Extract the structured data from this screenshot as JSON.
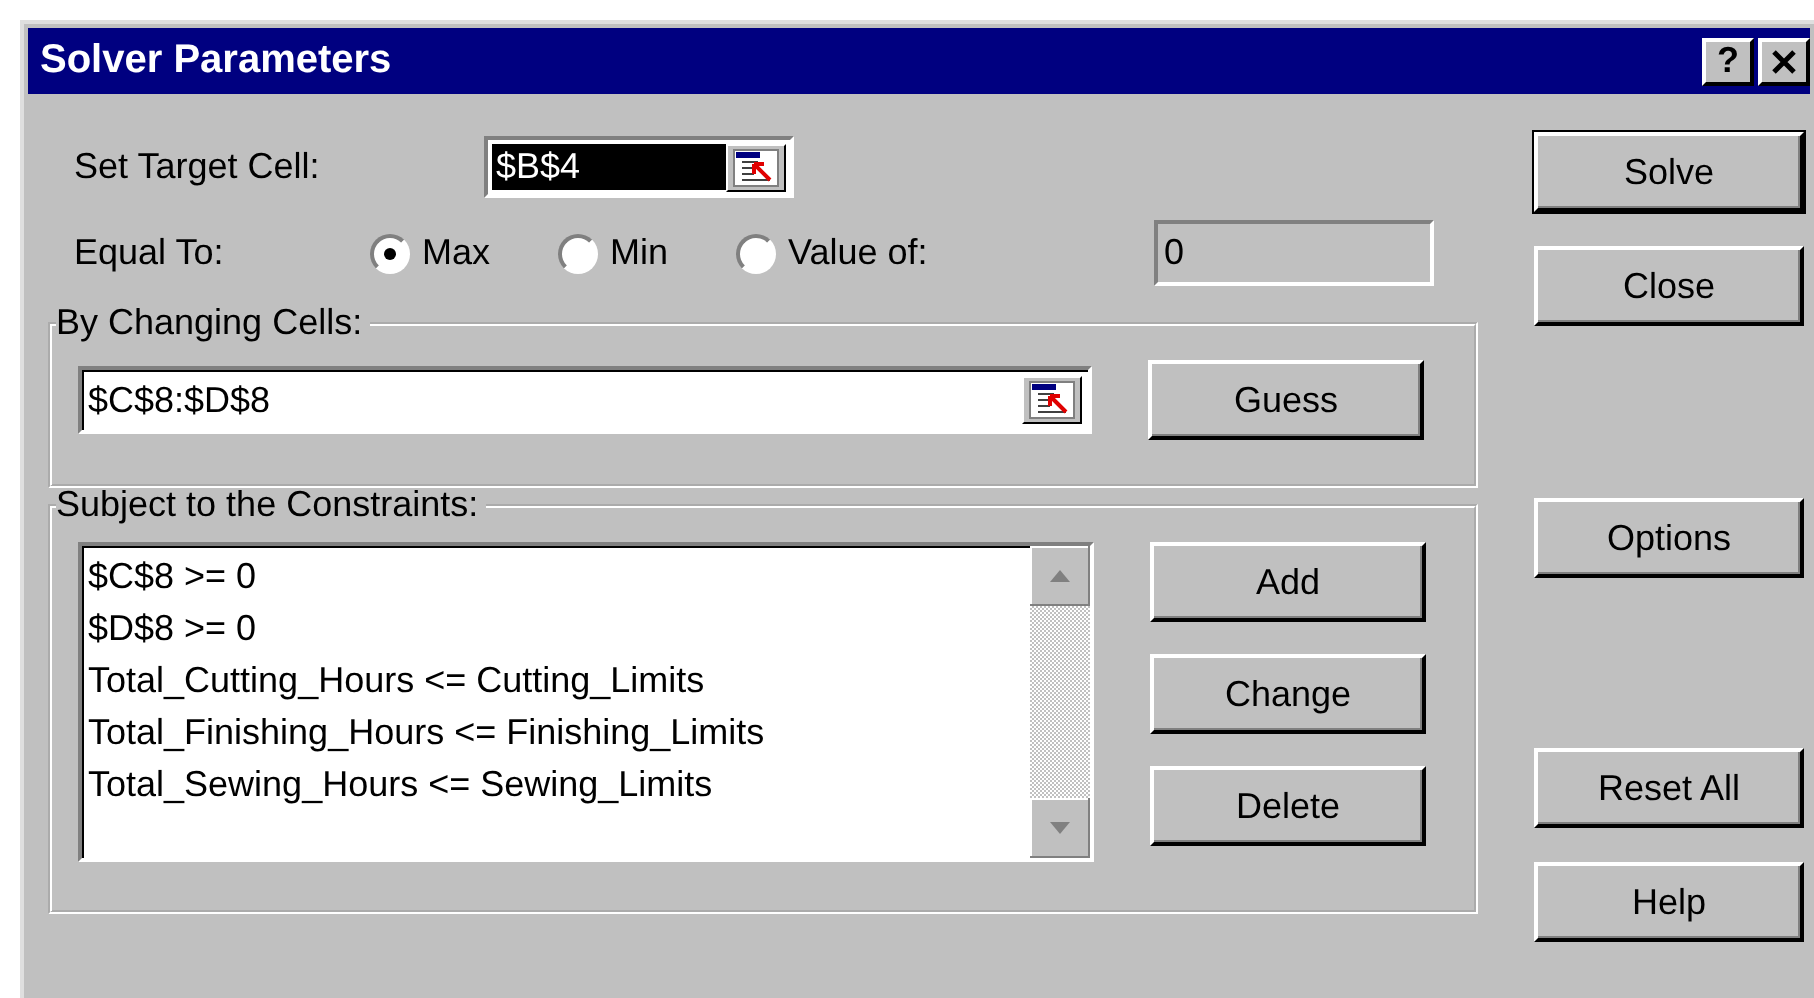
{
  "window": {
    "title": "Solver Parameters",
    "help_button": "?"
  },
  "target_cell": {
    "label": "Set Target Cell:",
    "value": "$B$4"
  },
  "equal_to": {
    "label": "Equal To:",
    "options": [
      {
        "label": "Max",
        "selected": true
      },
      {
        "label": "Min",
        "selected": false
      },
      {
        "label": "Value of:",
        "selected": false
      }
    ],
    "value": "0",
    "disabled": true
  },
  "changing_cells": {
    "title": "By Changing Cells:",
    "value": "$C$8:$D$8",
    "button": "Guess"
  },
  "constraints": {
    "title": "Subject to the Constraints:",
    "items": [
      "$C$8 >= 0",
      "$D$8 >= 0",
      "Total_Cutting_Hours <= Cutting_Limits",
      "Total_Finishing_Hours <= Finishing_Limits",
      "Total_Sewing_Hours <= Sewing_Limits"
    ],
    "buttons": [
      "Add",
      "Change",
      "Delete"
    ]
  },
  "side_buttons": [
    {
      "label": "Solve",
      "default": true
    },
    {
      "label": "Close",
      "default": false
    },
    {
      "label": "Options",
      "default": false
    },
    {
      "label": "Reset All",
      "default": false
    },
    {
      "label": "Help",
      "default": false
    }
  ]
}
